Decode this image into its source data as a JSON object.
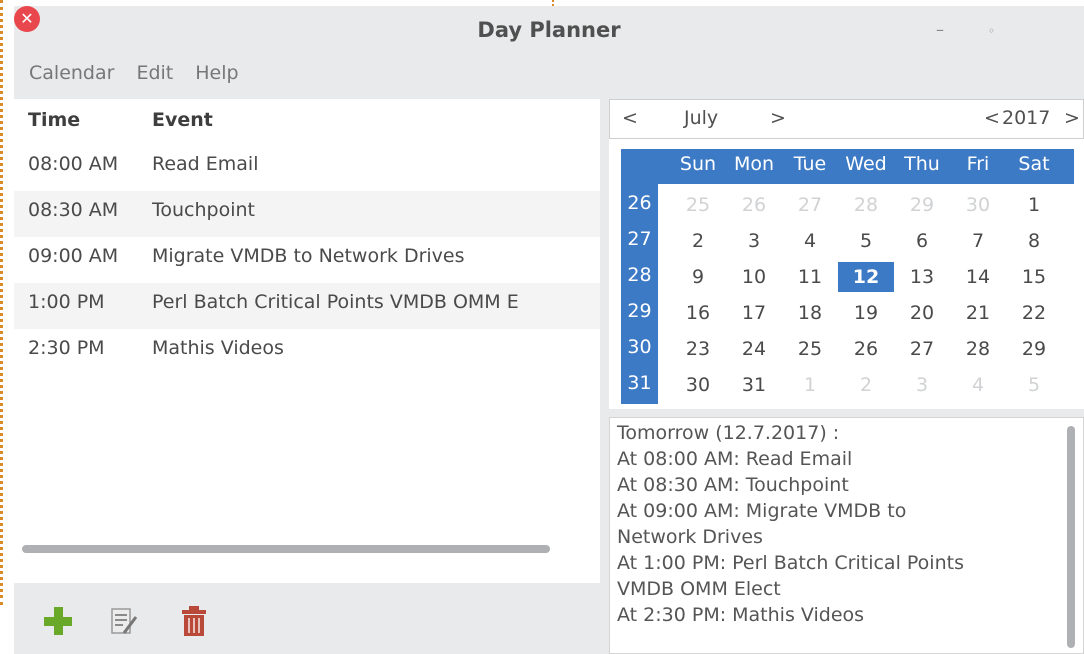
{
  "window": {
    "title": "Day Planner",
    "controls": {
      "minimize_icon": "–",
      "maximize_icon": "◦",
      "close_icon": "✕"
    }
  },
  "menu": [
    "Calendar",
    "Edit",
    "Help"
  ],
  "table": {
    "headers": {
      "time": "Time",
      "event": "Event"
    },
    "rows": [
      {
        "time": "08:00 AM",
        "event": "Read Email"
      },
      {
        "time": "08:30 AM",
        "event": "Touchpoint"
      },
      {
        "time": "09:00 AM",
        "event": "Migrate VMDB to Network Drives"
      },
      {
        "time": "1:00 PM",
        "event": "Perl Batch Critical Points VMDB OMM E"
      },
      {
        "time": "2:30 PM",
        "event": "Mathis Videos"
      }
    ]
  },
  "toolbar": {
    "add_icon": "plus-icon",
    "edit_icon": "edit-icon",
    "delete_icon": "trash-icon"
  },
  "calendar": {
    "prev_month": "<",
    "month": "July",
    "next_month": ">",
    "prev_year": "<",
    "year": "2017",
    "next_year": ">",
    "day_names": [
      "Sun",
      "Mon",
      "Tue",
      "Wed",
      "Thu",
      "Fri",
      "Sat"
    ],
    "weeks": [
      "26",
      "27",
      "28",
      "29",
      "30",
      "31"
    ],
    "days": [
      [
        "25",
        "26",
        "27",
        "28",
        "29",
        "30",
        "1"
      ],
      [
        "2",
        "3",
        "4",
        "5",
        "6",
        "7",
        "8"
      ],
      [
        "9",
        "10",
        "11",
        "12",
        "13",
        "14",
        "15"
      ],
      [
        "16",
        "17",
        "18",
        "19",
        "20",
        "21",
        "22"
      ],
      [
        "23",
        "24",
        "25",
        "26",
        "27",
        "28",
        "29"
      ],
      [
        "30",
        "31",
        "1",
        "2",
        "3",
        "4",
        "5"
      ]
    ],
    "selected_day": "12",
    "accent": "#3d7ac6"
  },
  "notes": [
    "Tomorrow (12.7.2017) :",
    "At 08:00 AM: Read Email",
    "At 08:30 AM: Touchpoint",
    "At 09:00 AM: Migrate VMDB to",
    "Network Drives",
    "At 1:00 PM: Perl Batch Critical Points",
    "VMDB OMM Elect",
    "At 2:30 PM: Mathis Videos"
  ],
  "colors": {
    "close": "#e8474e",
    "add": "#6aa82a",
    "delete": "#b94a3a"
  }
}
